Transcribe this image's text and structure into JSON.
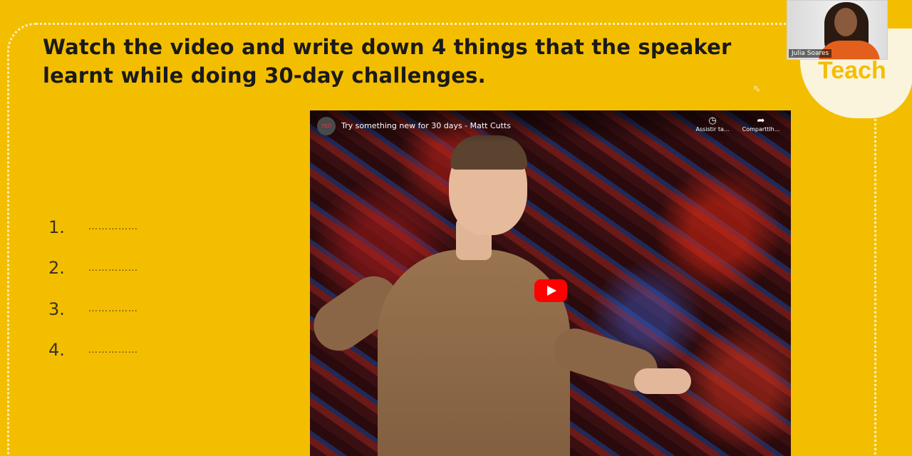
{
  "slide": {
    "title": "Watch the video and write down 4 things that the speaker learnt while doing 30-day challenges.",
    "blanks": [
      {
        "number": "1.",
        "line": "……………"
      },
      {
        "number": "2.",
        "line": "……………"
      },
      {
        "number": "3.",
        "line": "……………"
      },
      {
        "number": "4.",
        "line": "……………"
      }
    ],
    "logo_text": "Teach"
  },
  "webcam": {
    "participant_name": "Julia Soares"
  },
  "video": {
    "title": "Try something new for 30 days - Matt Cutts",
    "watch_later_label": "Assistir ta...",
    "share_label": "Comparttlh...",
    "play_icon": "youtube-play-icon",
    "play_color": "#FF0000"
  },
  "colors": {
    "slide_background": "#F4BE00",
    "title_text": "#1a1a1a"
  }
}
